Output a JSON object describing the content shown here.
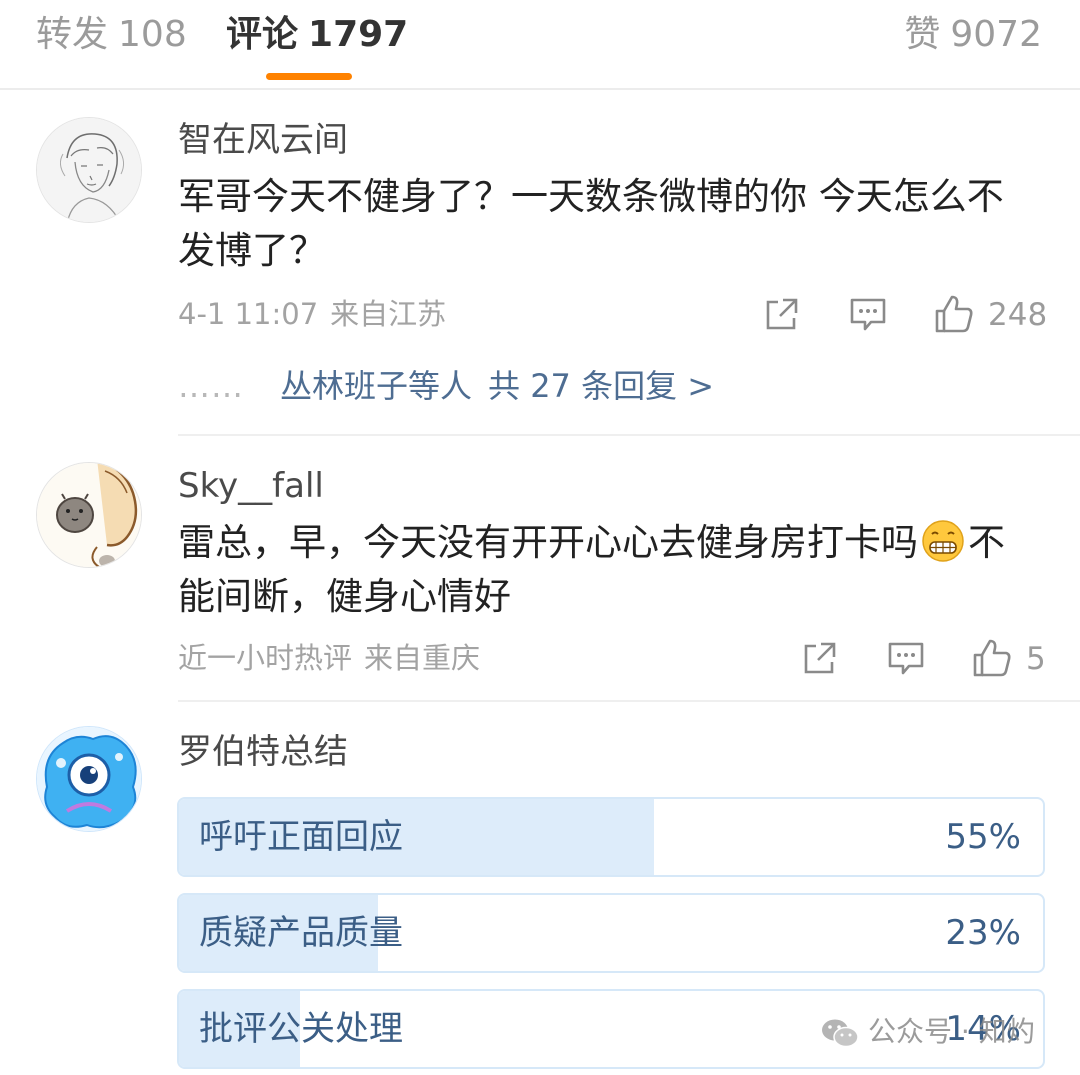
{
  "tabs": {
    "reposts": {
      "label": "转发",
      "count": "108"
    },
    "comments": {
      "label": "评论",
      "count": "1797"
    },
    "likes": {
      "label": "赞",
      "count": "9072"
    }
  },
  "comments": [
    {
      "username": "智在风云间",
      "text": "军哥今天不健身了？一天数条微博的你 今天怎么不发博了？",
      "time": "4-1 11:07",
      "location": "来自江苏",
      "likes": "248",
      "replies": {
        "dots": "……",
        "names": "丛林班子等人",
        "total": "共 27 条回复 >"
      }
    },
    {
      "username": "Sky__fall",
      "text_before_emoji": "雷总，早，今天没有开开心心去健身房打卡吗",
      "emoji": "grinning-face-emoji",
      "text_after_emoji": "不能间断，健身心情好",
      "time": "近一小时热评",
      "location": "来自重庆",
      "likes": "5"
    },
    {
      "username": "罗伯特总结",
      "poll": [
        {
          "label": "呼吁正面回应",
          "percent": "55%",
          "value": 55
        },
        {
          "label": "质疑产品质量",
          "percent": "23%",
          "value": 23
        },
        {
          "label": "批评公关处理",
          "percent": "14%",
          "value": 14
        }
      ]
    }
  ],
  "watermark": {
    "icon": "wechat-icon",
    "text": "公众号 · 知灼"
  },
  "colors": {
    "accent": "#ff8200",
    "link": "#4e6d92",
    "poll_fill": "#ddecfa",
    "poll_text": "#3b5e86"
  }
}
